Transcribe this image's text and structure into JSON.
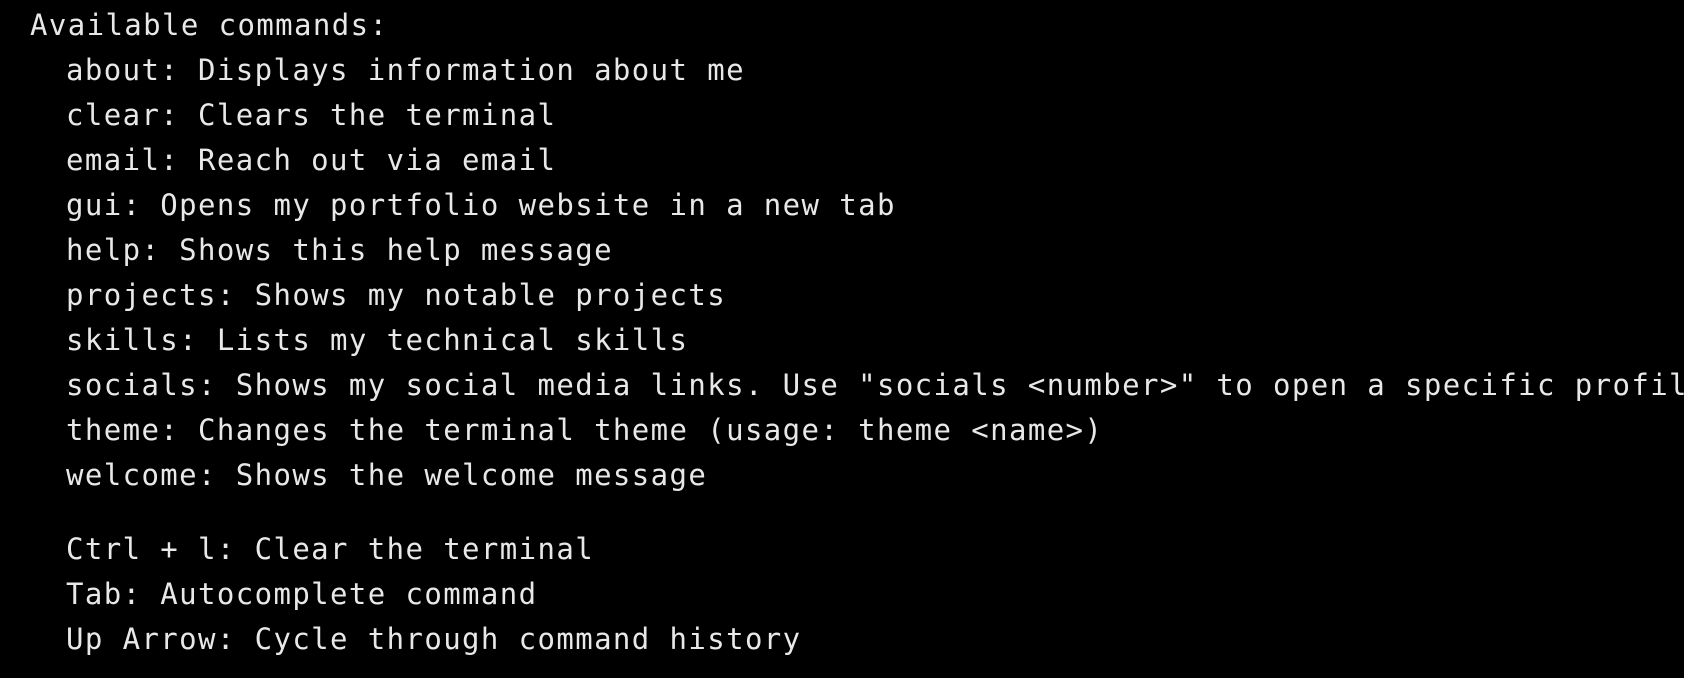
{
  "heading": "Available commands:",
  "commands": [
    "about: Displays information about me",
    "clear: Clears the terminal",
    "email: Reach out via email",
    "gui: Opens my portfolio website in a new tab",
    "help: Shows this help message",
    "projects: Shows my notable projects",
    "skills: Lists my technical skills",
    "socials: Shows my social media links. Use \"socials <number>\" to open a specific profile",
    "theme: Changes the terminal theme (usage: theme <name>)",
    "welcome: Shows the welcome message"
  ],
  "shortcuts": [
    "Ctrl + l: Clear the terminal",
    "Tab: Autocomplete command",
    "Up Arrow: Cycle through command history"
  ],
  "colors": {
    "background": "#000000",
    "text": "#e8e8e8"
  }
}
